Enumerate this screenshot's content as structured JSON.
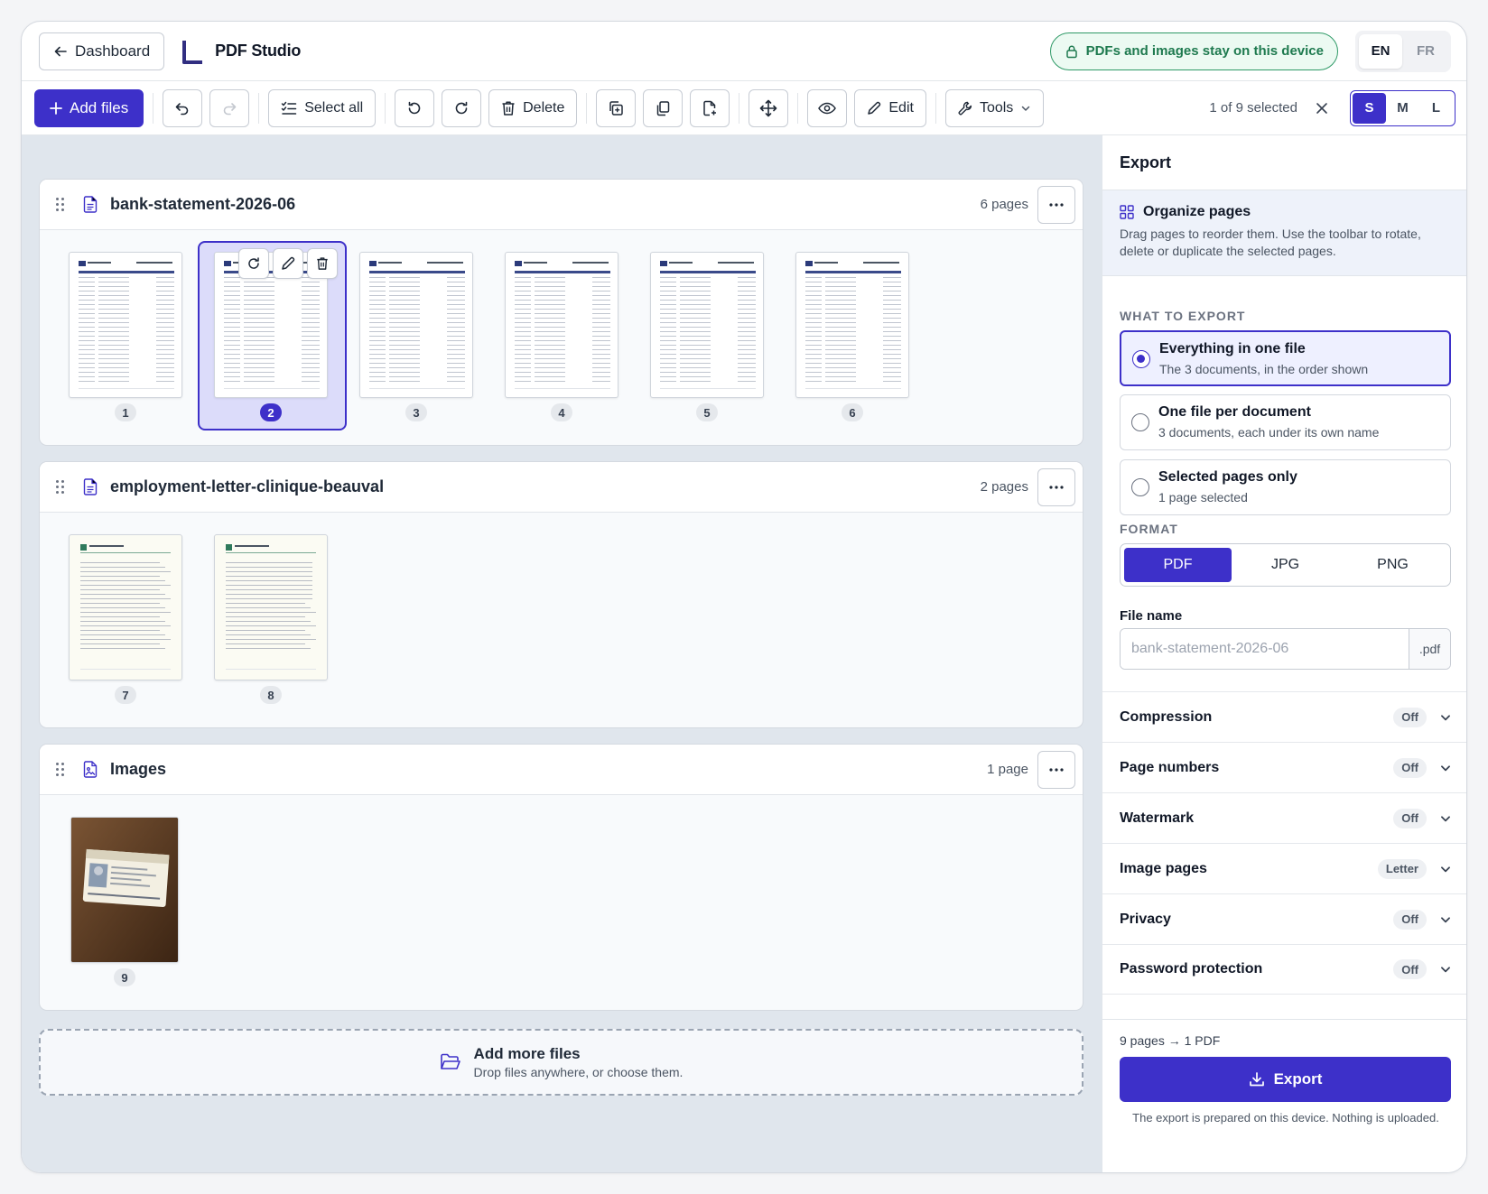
{
  "header": {
    "back_label": "Dashboard",
    "title": "PDF Studio",
    "privacy_note": "PDFs and images stay on this device",
    "languages": [
      "EN",
      "FR"
    ],
    "active_language": "EN"
  },
  "toolbar": {
    "add_files": "Add files",
    "select_all": "Select all",
    "delete": "Delete",
    "edit": "Edit",
    "tools": "Tools",
    "selection_count": "1 of 9 selected",
    "sizes": [
      "S",
      "M",
      "L"
    ],
    "active_size": "S"
  },
  "documents": [
    {
      "name": "bank-statement-2026-06",
      "page_count": "6 pages",
      "pages": [
        "1",
        "2",
        "3",
        "4",
        "5",
        "6"
      ],
      "selected_page": "2"
    },
    {
      "name": "employment-letter-clinique-beauval",
      "page_count": "2 pages",
      "pages": [
        "7",
        "8"
      ]
    },
    {
      "name": "Images",
      "page_count": "1 page",
      "pages": [
        "9"
      ]
    }
  ],
  "dropzone": {
    "title": "Add more files",
    "subtitle": "Drop files anywhere, or choose them."
  },
  "panel": {
    "title": "Export",
    "info_title": "Organize pages",
    "info_text": "Drag pages to reorder them. Use the toolbar to rotate, delete or duplicate the selected pages.",
    "what_label": "WHAT TO EXPORT",
    "options": [
      {
        "title": "Everything in one file",
        "subtitle": "The 3 documents, in the order shown",
        "selected": true
      },
      {
        "title": "One file per document",
        "subtitle": "3 documents, each under its own name",
        "selected": false
      },
      {
        "title": "Selected pages only",
        "subtitle": "1 page selected",
        "selected": false
      }
    ],
    "format_label": "FORMAT",
    "formats": [
      "PDF",
      "JPG",
      "PNG"
    ],
    "active_format": "PDF",
    "filename_label": "File name",
    "filename_placeholder": "bank-statement-2026-06",
    "filename_ext": ".pdf",
    "settings": [
      {
        "title": "Compression",
        "value": "Off"
      },
      {
        "title": "Page numbers",
        "value": "Off"
      },
      {
        "title": "Watermark",
        "value": "Off"
      },
      {
        "title": "Image pages",
        "value": "Letter"
      },
      {
        "title": "Privacy",
        "value": "Off"
      },
      {
        "title": "Password protection",
        "value": "Off"
      }
    ],
    "summary": "9 pages → 1 PDF",
    "export_label": "Export",
    "footnote": "The export is prepared on this device. Nothing is uploaded."
  },
  "colors": {
    "accent": "#3d30c9",
    "privacy_green": "#2f9a67",
    "workspace_bg": "#e0e6ed"
  }
}
